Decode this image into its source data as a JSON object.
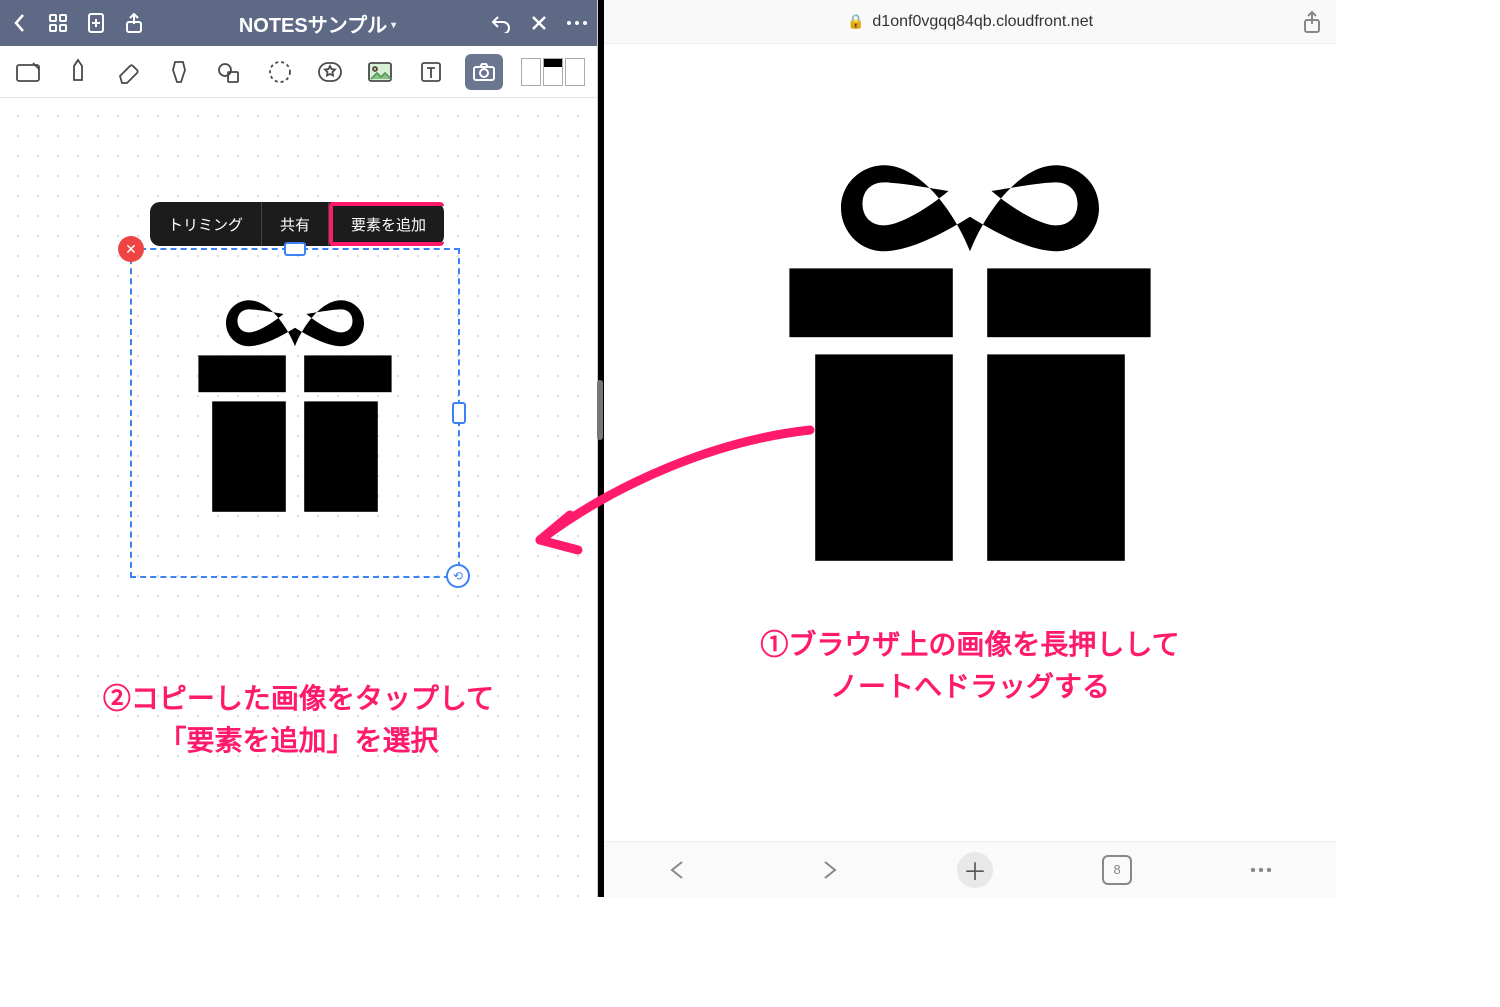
{
  "left_app": {
    "title": "NOTESサンプル",
    "context_menu": {
      "trim": "トリミング",
      "share": "共有",
      "add_element": "要素を追加"
    },
    "instruction_line1": "②コピーした画像をタップして",
    "instruction_line2": "「要素を追加」を選択"
  },
  "right_app": {
    "url": "d1onf0vgqq84qb.cloudfront.net",
    "instruction_line1": "①ブラウザ上の画像を長押しして",
    "instruction_line2": "ノートへドラッグする",
    "tab_count": "8"
  }
}
